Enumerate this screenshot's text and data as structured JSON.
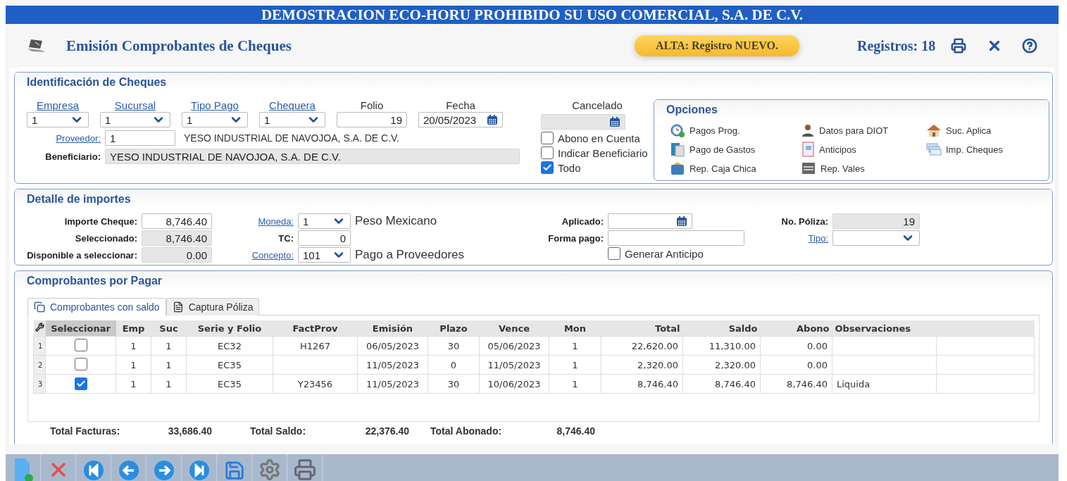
{
  "banner": {
    "title": "DEMOSTRACION ECO-HORU PROHIBIDO SU USO COMERCIAL, S.A. DE C.V."
  },
  "header": {
    "title": "Emisión Comprobantes de Cheques",
    "status": "ALTA: Registro NUEVO.",
    "records": "Registros: 18"
  },
  "identificacion": {
    "title": "Identificación de Cheques",
    "top_fields": [
      {
        "kind": "select",
        "label": "Empresa",
        "link": true,
        "value": "1"
      },
      {
        "kind": "select",
        "label": "Sucursal",
        "link": true,
        "value": "1"
      },
      {
        "kind": "select",
        "label": "Tipo Pago",
        "link": true,
        "value": "1"
      },
      {
        "kind": "select",
        "label": "Chequera",
        "link": true,
        "value": "1"
      },
      {
        "kind": "text",
        "label": "Folio",
        "link": false,
        "value": "19"
      },
      {
        "kind": "date",
        "label": "Fecha",
        "link": false,
        "value": "20/05/2023"
      }
    ],
    "cancelado": {
      "label": "Cancelado",
      "disabled": true
    },
    "proveedor": {
      "label": "Proveedor:",
      "value": "1",
      "name": "YESO INDUSTRIAL DE NAVOJOA, S.A. DE C.V."
    },
    "beneficiario": {
      "label": "Beneficiario:",
      "value": "YESO INDUSTRIAL DE NAVOJOA, S.A. DE C.V.",
      "disabled": true
    },
    "checks": [
      {
        "label": "Abono en Cuenta",
        "checked": false
      },
      {
        "label": "Indicar Beneficiario",
        "checked": false
      },
      {
        "label": "Todo",
        "checked": true
      }
    ]
  },
  "opciones": {
    "title": "Opciones",
    "items": [
      {
        "label": "Pagos Prog."
      },
      {
        "label": "Datos para DIOT"
      },
      {
        "label": "Suc. Aplica"
      },
      {
        "label": "Pago de Gastos"
      },
      {
        "label": "Anticipos"
      },
      {
        "label": "Imp. Cheques"
      },
      {
        "label": "Rep. Caja Chica"
      },
      {
        "label": "Rep. Vales"
      }
    ]
  },
  "detalle": {
    "title": "Detalle de importes",
    "columns": [
      [
        {
          "kind": "text",
          "label": "Importe Cheque:",
          "link": false,
          "value": "8,746.40",
          "disabled": false
        },
        {
          "kind": "text",
          "label": "Seleccionado:",
          "link": false,
          "value": "8,746.40",
          "disabled": true
        },
        {
          "kind": "text",
          "label": "Disponible a seleccionar:",
          "link": false,
          "value": "0.00",
          "disabled": true
        }
      ],
      [
        {
          "kind": "select",
          "label": "Moneda:",
          "link": true,
          "value": "1",
          "description": "Peso Mexicano"
        },
        {
          "kind": "text",
          "label": "TC:",
          "link": false,
          "value": "0",
          "disabled": false
        },
        {
          "kind": "select",
          "label": "Concepto:",
          "link": true,
          "value": "101",
          "description": "Pago a Proveedores"
        }
      ],
      [
        {
          "kind": "date",
          "label": "Aplicado:",
          "link": false
        },
        {
          "kind": "text",
          "label": "Forma pago:",
          "link": false,
          "disabled": false
        },
        {
          "kind": "check",
          "label": "Generar Anticipo",
          "checked": false
        }
      ],
      [
        {
          "kind": "text",
          "label": "No. Póliza:",
          "link": false,
          "value": "19",
          "disabled": true
        },
        {
          "kind": "select",
          "label": "Tipo:",
          "link": true
        }
      ]
    ]
  },
  "comprobantes": {
    "title": "Comprobantes por Pagar",
    "tabs": [
      {
        "label": "Comprobantes con saldo",
        "selected": true
      },
      {
        "label": "Captura Póliza",
        "selected": false
      }
    ],
    "table": {
      "select_column": {
        "label": "Seleccionar",
        "sorted": true
      },
      "columns": [
        {
          "label": "Emp",
          "sorted": false
        },
        {
          "label": "Suc",
          "sorted": false
        },
        {
          "label": "Serie y Folio",
          "sorted": false
        },
        {
          "label": "FactProv",
          "sorted": false
        },
        {
          "label": "Emisión",
          "sorted": false
        },
        {
          "label": "Plazo",
          "sorted": false
        },
        {
          "label": "Vence",
          "sorted": false
        },
        {
          "label": "Mon",
          "sorted": false
        },
        {
          "label": "Total",
          "sorted": false
        },
        {
          "label": "Saldo",
          "sorted": false
        },
        {
          "label": "Abono",
          "sorted": false
        },
        {
          "label": "Observaciones",
          "sorted": false
        }
      ],
      "rows": [
        {
          "number": "1",
          "checked": false,
          "cells": [
            "1",
            "1",
            "EC32",
            "H1267",
            "06/05/2023",
            "30",
            "05/06/2023",
            "1",
            "22,620.00",
            "11,310.00",
            "0.00",
            null
          ]
        },
        {
          "number": "2",
          "checked": false,
          "cells": [
            "1",
            "1",
            "EC35",
            null,
            "11/05/2023",
            "0",
            "11/05/2023",
            "1",
            "2,320.00",
            "2,320.00",
            "0.00",
            null
          ]
        },
        {
          "number": "3",
          "checked": true,
          "cells": [
            "1",
            "1",
            "EC35",
            "Y23456",
            "11/05/2023",
            "30",
            "10/06/2023",
            "1",
            "8,746.40",
            "8,746.40",
            "8,746.40",
            "Liquida"
          ]
        }
      ]
    },
    "totals": [
      {
        "label": "Total Facturas:",
        "value": "33,686.40"
      },
      {
        "label": "Total Saldo:",
        "value": "22,376.40"
      },
      {
        "label": "Total Abonado:",
        "value": "8,746.40"
      }
    ]
  }
}
